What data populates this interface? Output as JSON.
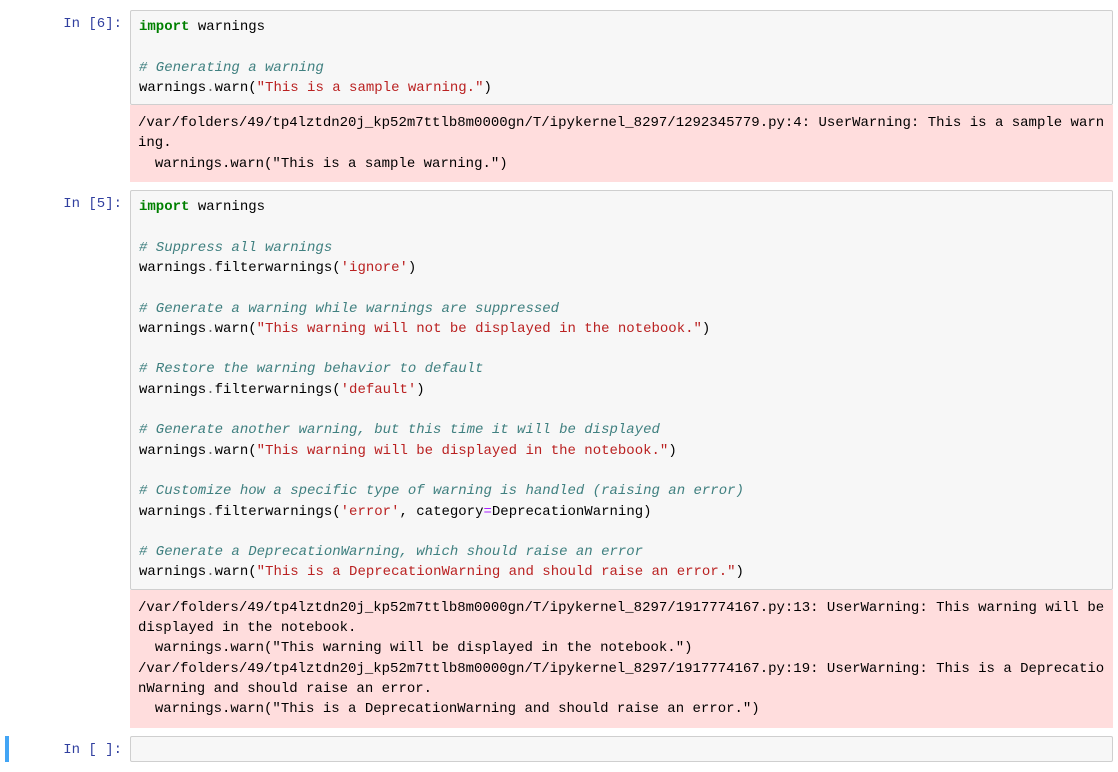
{
  "cells": [
    {
      "execution_count": 6,
      "prompt": "In [6]:",
      "code_tokens": [
        {
          "t": "import",
          "c": "kw"
        },
        {
          "t": " warnings\n",
          "c": "nm"
        },
        {
          "t": "\n",
          "c": ""
        },
        {
          "t": "# Generating a warning\n",
          "c": "cm"
        },
        {
          "t": "warnings",
          "c": "nm"
        },
        {
          "t": ".",
          "c": "op"
        },
        {
          "t": "warn(",
          "c": "nm"
        },
        {
          "t": "\"This is a sample warning.\"",
          "c": "st"
        },
        {
          "t": ")",
          "c": "nm"
        }
      ],
      "stderr": "/var/folders/49/tp4lztdn20j_kp52m7ttlb8m0000gn/T/ipykernel_8297/1292345779.py:4: UserWarning: This is a sample warning.\n  warnings.warn(\"This is a sample warning.\")"
    },
    {
      "execution_count": 5,
      "prompt": "In [5]:",
      "code_tokens": [
        {
          "t": "import",
          "c": "kw"
        },
        {
          "t": " warnings\n",
          "c": "nm"
        },
        {
          "t": "\n",
          "c": ""
        },
        {
          "t": "# Suppress all warnings\n",
          "c": "cm"
        },
        {
          "t": "warnings",
          "c": "nm"
        },
        {
          "t": ".",
          "c": "op"
        },
        {
          "t": "filterwarnings(",
          "c": "nm"
        },
        {
          "t": "'ignore'",
          "c": "st"
        },
        {
          "t": ")\n",
          "c": "nm"
        },
        {
          "t": "\n",
          "c": ""
        },
        {
          "t": "# Generate a warning while warnings are suppressed\n",
          "c": "cm"
        },
        {
          "t": "warnings",
          "c": "nm"
        },
        {
          "t": ".",
          "c": "op"
        },
        {
          "t": "warn(",
          "c": "nm"
        },
        {
          "t": "\"This warning will not be displayed in the notebook.\"",
          "c": "st"
        },
        {
          "t": ")\n",
          "c": "nm"
        },
        {
          "t": "\n",
          "c": ""
        },
        {
          "t": "# Restore the warning behavior to default\n",
          "c": "cm"
        },
        {
          "t": "warnings",
          "c": "nm"
        },
        {
          "t": ".",
          "c": "op"
        },
        {
          "t": "filterwarnings(",
          "c": "nm"
        },
        {
          "t": "'default'",
          "c": "st"
        },
        {
          "t": ")\n",
          "c": "nm"
        },
        {
          "t": "\n",
          "c": ""
        },
        {
          "t": "# Generate another warning, but this time it will be displayed\n",
          "c": "cm"
        },
        {
          "t": "warnings",
          "c": "nm"
        },
        {
          "t": ".",
          "c": "op"
        },
        {
          "t": "warn(",
          "c": "nm"
        },
        {
          "t": "\"This warning will be displayed in the notebook.\"",
          "c": "st"
        },
        {
          "t": ")\n",
          "c": "nm"
        },
        {
          "t": "\n",
          "c": ""
        },
        {
          "t": "# Customize how a specific type of warning is handled (raising an error)\n",
          "c": "cm"
        },
        {
          "t": "warnings",
          "c": "nm"
        },
        {
          "t": ".",
          "c": "op"
        },
        {
          "t": "filterwarnings(",
          "c": "nm"
        },
        {
          "t": "'error'",
          "c": "st"
        },
        {
          "t": ", category",
          "c": "nm"
        },
        {
          "t": "=",
          "c": "eq"
        },
        {
          "t": "DeprecationWarning)\n",
          "c": "nm"
        },
        {
          "t": "\n",
          "c": ""
        },
        {
          "t": "# Generate a DeprecationWarning, which should raise an error\n",
          "c": "cm"
        },
        {
          "t": "warnings",
          "c": "nm"
        },
        {
          "t": ".",
          "c": "op"
        },
        {
          "t": "warn(",
          "c": "nm"
        },
        {
          "t": "\"This is a DeprecationWarning and should raise an error.\"",
          "c": "st"
        },
        {
          "t": ")",
          "c": "nm"
        }
      ],
      "stderr": "/var/folders/49/tp4lztdn20j_kp52m7ttlb8m0000gn/T/ipykernel_8297/1917774167.py:13: UserWarning: This warning will be displayed in the notebook.\n  warnings.warn(\"This warning will be displayed in the notebook.\")\n/var/folders/49/tp4lztdn20j_kp52m7ttlb8m0000gn/T/ipykernel_8297/1917774167.py:19: UserWarning: This is a DeprecationWarning and should raise an error.\n  warnings.warn(\"This is a DeprecationWarning and should raise an error.\")"
    }
  ],
  "empty_cell_prompt": "In [ ]:"
}
